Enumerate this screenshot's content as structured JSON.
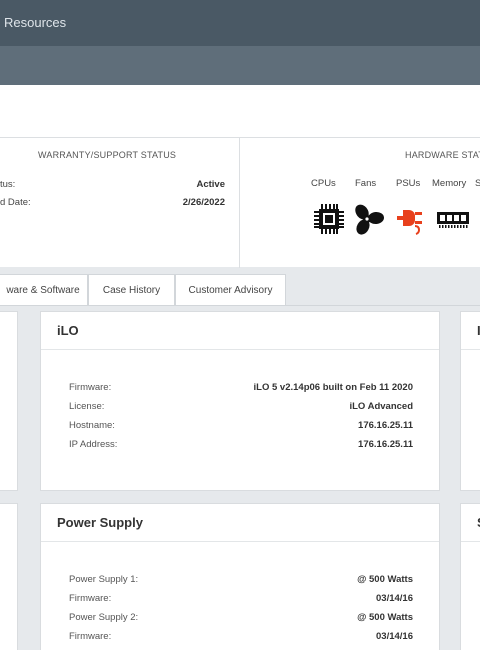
{
  "header": {
    "title": "Resources"
  },
  "warranty": {
    "heading": "WARRANTY/SUPPORT STATUS",
    "rows": [
      {
        "label": "tus:",
        "value": "Active"
      },
      {
        "label": "d Date:",
        "value": "2/26/2022"
      }
    ]
  },
  "hardware": {
    "heading": "HARDWARE STAT",
    "items": [
      {
        "label": "CPUs",
        "icon": "cpu-icon"
      },
      {
        "label": "Fans",
        "icon": "fan-icon"
      },
      {
        "label": "PSUs",
        "icon": "power-plug-icon"
      },
      {
        "label": "Memory",
        "icon": "memory-icon"
      },
      {
        "label": "S",
        "icon": ""
      }
    ],
    "colors": {
      "ok": "#111111",
      "alert": "#e8401c"
    }
  },
  "tabs": [
    {
      "label": "ware & Software"
    },
    {
      "label": "Case History"
    },
    {
      "label": "Customer Advisory"
    }
  ],
  "cards": {
    "ilo": {
      "title": "iLO",
      "rows": [
        {
          "label": "Firmware:",
          "value": "iLO 5 v2.14p06 built on Feb 11 2020"
        },
        {
          "label": "License:",
          "value": "iLO Advanced"
        },
        {
          "label": "Hostname:",
          "value": "176.16.25.11"
        },
        {
          "label": "IP Address:",
          "value": "176.16.25.11"
        }
      ]
    },
    "power": {
      "title": "Power Supply",
      "rows": [
        {
          "label": "Power Supply 1:",
          "value": "@ 500 Watts"
        },
        {
          "label": "Firmware:",
          "value": "03/14/16"
        },
        {
          "label": "Power Supply 2:",
          "value": "@ 500 Watts"
        },
        {
          "label": "Firmware:",
          "value": "03/14/16"
        }
      ]
    },
    "right_top": {
      "title": "I"
    },
    "right_bottom": {
      "title": "S"
    }
  }
}
